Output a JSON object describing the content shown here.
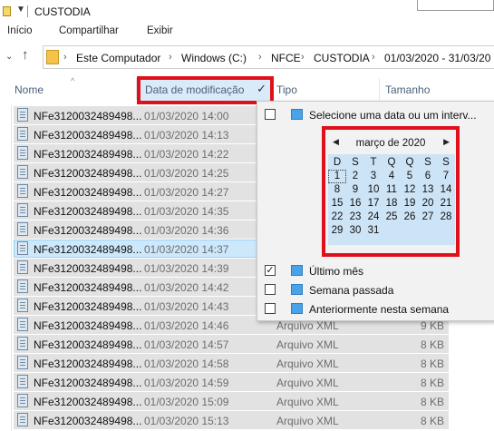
{
  "window": {
    "title": "CUSTODIA"
  },
  "ribbon": {
    "tabs": [
      "Início",
      "Compartilhar",
      "Exibir"
    ]
  },
  "address": {
    "back": "‹",
    "forward": "›",
    "recent": "⌄",
    "up": "↑",
    "crumbs": [
      "Este Computador",
      "Windows (C:)",
      "NFCE",
      "CUSTODIA",
      "01/03/2020 - 31/03/20"
    ]
  },
  "columns": {
    "name": "Nome",
    "date": "Data de modificação",
    "type": "Tipo",
    "size": "Tamanho"
  },
  "files": [
    {
      "name": "NFe3120032489498...",
      "date": "01/03/2020 14:00",
      "type": "",
      "size": ""
    },
    {
      "name": "NFe3120032489498...",
      "date": "01/03/2020 14:13",
      "type": "",
      "size": ""
    },
    {
      "name": "NFe3120032489498...",
      "date": "01/03/2020 14:22",
      "type": "",
      "size": ""
    },
    {
      "name": "NFe3120032489498...",
      "date": "01/03/2020 14:25",
      "type": "",
      "size": ""
    },
    {
      "name": "NFe3120032489498...",
      "date": "01/03/2020 14:27",
      "type": "",
      "size": ""
    },
    {
      "name": "NFe3120032489498...",
      "date": "01/03/2020 14:35",
      "type": "",
      "size": ""
    },
    {
      "name": "NFe3120032489498...",
      "date": "01/03/2020 14:36",
      "type": "",
      "size": ""
    },
    {
      "name": "NFe3120032489498...",
      "date": "01/03/2020 14:37",
      "type": "",
      "size": "",
      "selected": true
    },
    {
      "name": "NFe3120032489498...",
      "date": "01/03/2020 14:39",
      "type": "",
      "size": ""
    },
    {
      "name": "NFe3120032489498...",
      "date": "01/03/2020 14:42",
      "type": "",
      "size": ""
    },
    {
      "name": "NFe3120032489498...",
      "date": "01/03/2020 14:43",
      "type": "",
      "size": ""
    },
    {
      "name": "NFe3120032489498...",
      "date": "01/03/2020 14:46",
      "type": "Arquivo XML",
      "size": "9 KB"
    },
    {
      "name": "NFe3120032489498...",
      "date": "01/03/2020 14:57",
      "type": "Arquivo XML",
      "size": "8 KB"
    },
    {
      "name": "NFe3120032489498...",
      "date": "01/03/2020 14:58",
      "type": "Arquivo XML",
      "size": "8 KB"
    },
    {
      "name": "NFe3120032489498...",
      "date": "01/03/2020 14:59",
      "type": "Arquivo XML",
      "size": "8 KB"
    },
    {
      "name": "NFe3120032489498...",
      "date": "01/03/2020 15:09",
      "type": "Arquivo XML",
      "size": "8 KB"
    },
    {
      "name": "NFe3120032489498...",
      "date": "01/03/2020 15:13",
      "type": "Arquivo XML",
      "size": "8 KB"
    }
  ],
  "filter": {
    "select_date": {
      "label": "Selecione uma data ou um interv...",
      "checked": false
    },
    "calendar": {
      "month": "março de 2020",
      "prev": "◀",
      "next": "▶",
      "weekdays": [
        "D",
        "S",
        "T",
        "Q",
        "Q",
        "S",
        "S"
      ],
      "today": 1,
      "days": [
        1,
        2,
        3,
        4,
        5,
        6,
        7,
        8,
        9,
        10,
        11,
        12,
        13,
        14,
        15,
        16,
        17,
        18,
        19,
        20,
        21,
        22,
        23,
        24,
        25,
        26,
        27,
        28,
        29,
        30,
        31
      ]
    },
    "options": [
      {
        "label": "Último mês",
        "checked": true
      },
      {
        "label": "Semana passada",
        "checked": false
      },
      {
        "label": "Anteriormente nesta semana",
        "checked": false
      }
    ]
  },
  "colors": {
    "highlight": "#e0101b",
    "selection": "#cde8fb",
    "calendar_bg": "#cde4f7"
  }
}
